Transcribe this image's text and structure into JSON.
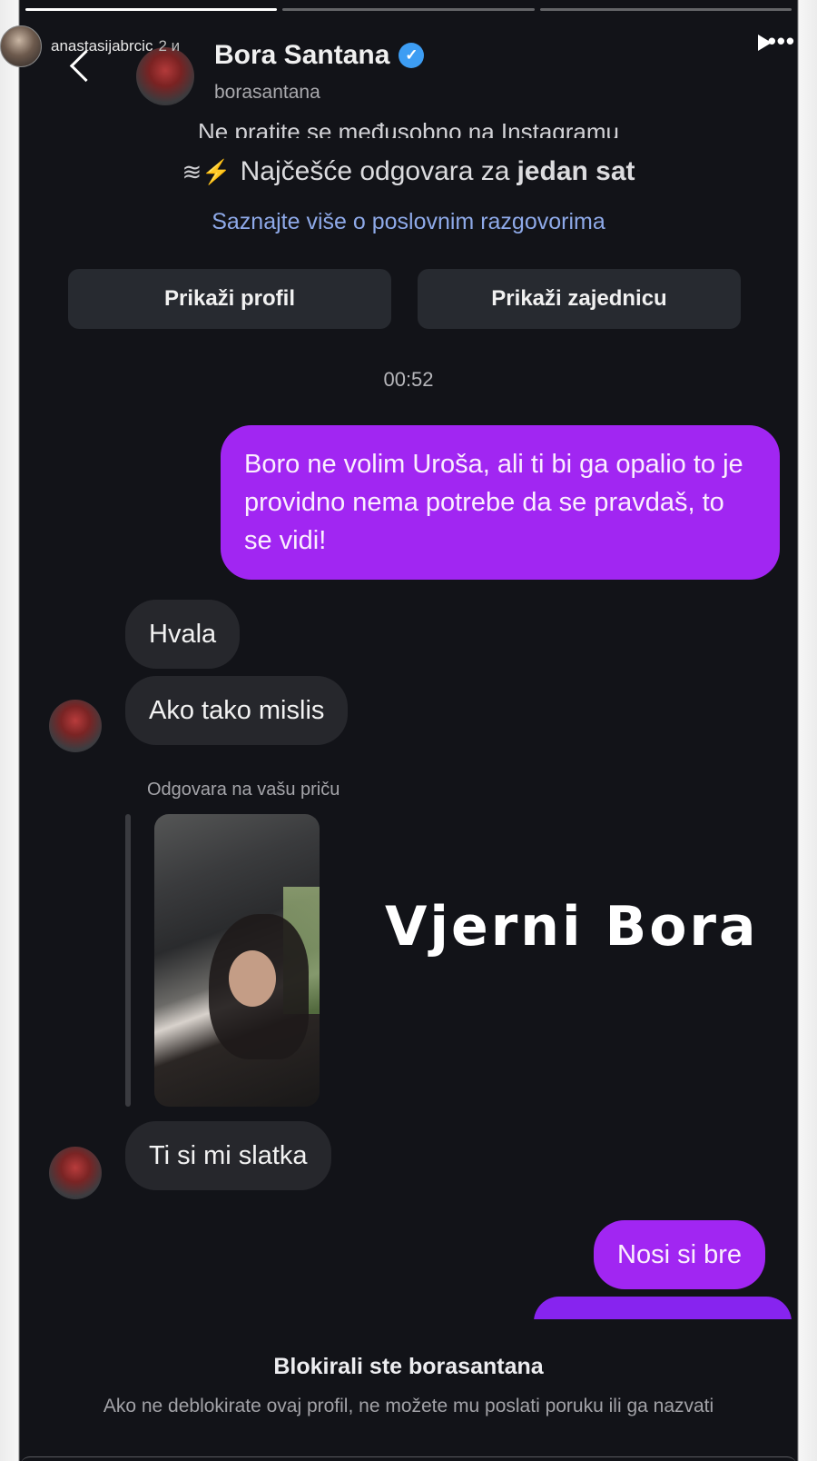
{
  "story": {
    "username": "anastasijabrcic",
    "time": "2 и"
  },
  "header": {
    "name": "Bora Santana",
    "handle": "borasantana",
    "verified_mark": "✓"
  },
  "info": {
    "cut_line": "Ne pratite se međusobno na Instagramu",
    "reply_prefix": "Najčešće odgovara za",
    "reply_bold": "jedan sat",
    "learn_more": "Saznajte više o poslovnim razgovorima"
  },
  "buttons": {
    "view_profile": "Prikaži profil",
    "view_community": "Prikaži zajednicu"
  },
  "messages": {
    "timestamp": "00:52",
    "m1": "Boro ne volim Uroša, ali ti bi ga opalio to je providno nema potrebe da se pravdaš, to se vidi!",
    "m2": "Hvala",
    "m3": "Ako tako mislis",
    "reply_label": "Odgovara na vašu priču",
    "m4": "Ti si mi slatka",
    "m5": "Nosi si bre"
  },
  "caption": "Vjerni Bora",
  "blocked": {
    "title": "Blokirali ste borasantana",
    "text": "Ako ne deblokirate ovaj profil, ne možete mu poslati poruku ili ga nazvati"
  },
  "colors": {
    "outgoing_bubble": "#a126f2",
    "incoming_bubble": "#26272c",
    "link": "#8ea9e8",
    "background": "#121318"
  }
}
